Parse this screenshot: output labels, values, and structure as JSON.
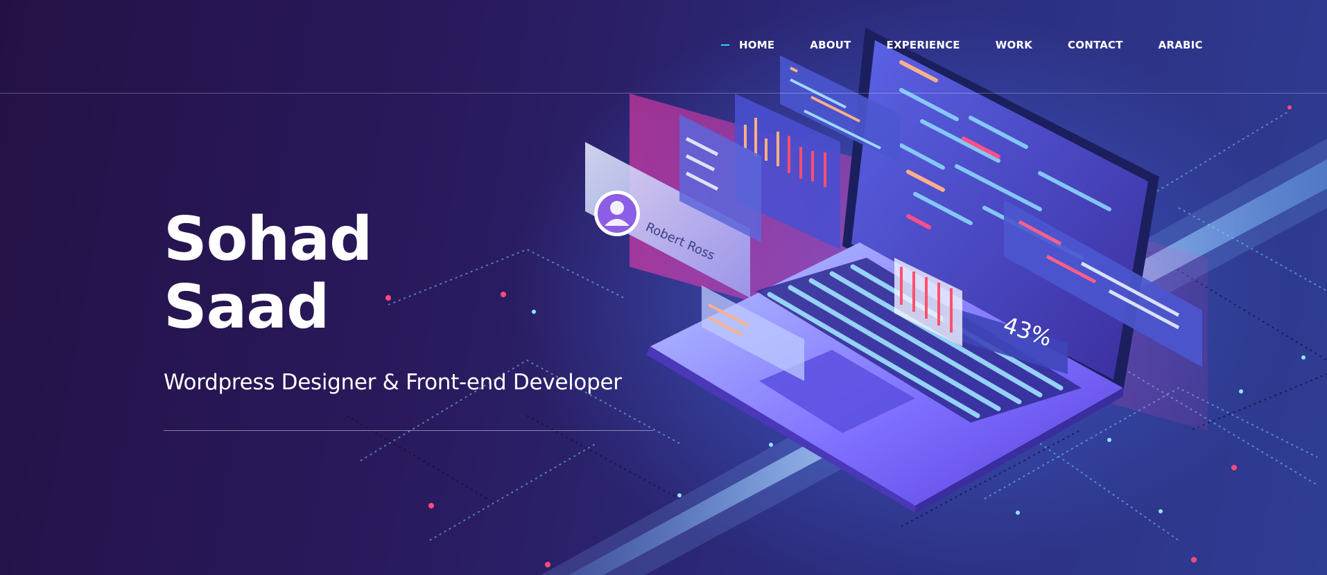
{
  "nav": {
    "items": [
      {
        "label": "HOME",
        "active": true
      },
      {
        "label": "ABOUT",
        "active": false
      },
      {
        "label": "EXPERIENCE",
        "active": false
      },
      {
        "label": "WORK",
        "active": false
      },
      {
        "label": "CONTACT",
        "active": false
      },
      {
        "label": "ARABIC",
        "active": false
      }
    ]
  },
  "hero": {
    "name_first": "Sohad",
    "name_last": "Saad",
    "tagline": "Wordpress Designer & Front-end Developer",
    "illustration": {
      "profile_card_name": "Robert Ross",
      "progress_label": "43%"
    }
  },
  "colors": {
    "accent": "#2fd3ff",
    "background_dark": "#231146",
    "background_light": "#2f3d94",
    "neon_pink": "#ff3fd0"
  }
}
